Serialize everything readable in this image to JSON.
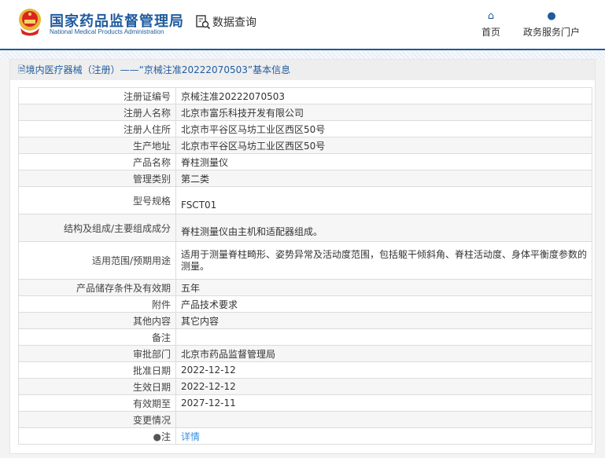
{
  "header": {
    "logo_cn": "国家药品监督管理局",
    "logo_en": "National Medical Products Administration",
    "query_label": "数据查询",
    "nav": [
      {
        "label": "首页",
        "icon": "home-icon"
      },
      {
        "label": "政务服务门户",
        "icon": "user-icon"
      }
    ]
  },
  "panel": {
    "title": "境内医疗器械（注册）——“京械注准20222070503”基本信息"
  },
  "rows": [
    {
      "label": "注册证编号",
      "value": "京械注准20222070503"
    },
    {
      "label": "注册人名称",
      "value": "北京市富乐科技开发有限公司"
    },
    {
      "label": "注册人住所",
      "value": "北京市平谷区马坊工业区西区50号"
    },
    {
      "label": "生产地址",
      "value": "北京市平谷区马坊工业区西区50号"
    },
    {
      "label": "产品名称",
      "value": "脊柱测量仪"
    },
    {
      "label": "管理类别",
      "value": "第二类"
    },
    {
      "label": "型号规格",
      "value": "FSCT01"
    },
    {
      "label": "结构及组成/主要组成成分",
      "value": "脊柱测量仪由主机和适配器组成。"
    },
    {
      "label": "适用范围/预期用途",
      "value": "适用于测量脊柱畸形、姿势异常及活动度范围，包括躯干倾斜角、脊柱活动度、身体平衡度参数的测量。"
    },
    {
      "label": "产品储存条件及有效期",
      "value": "五年"
    },
    {
      "label": "附件",
      "value": "产品技术要求"
    },
    {
      "label": "其他内容",
      "value": "其它内容"
    },
    {
      "label": "备注",
      "value": ""
    },
    {
      "label": "审批部门",
      "value": "北京市药品监督管理局"
    },
    {
      "label": "批准日期",
      "value": "2022-12-12"
    },
    {
      "label": "生效日期",
      "value": "2022-12-12"
    },
    {
      "label": "有效期至",
      "value": "2027-12-11"
    },
    {
      "label": "变更情况",
      "value": ""
    },
    {
      "label": "注",
      "value": "详情"
    }
  ]
}
